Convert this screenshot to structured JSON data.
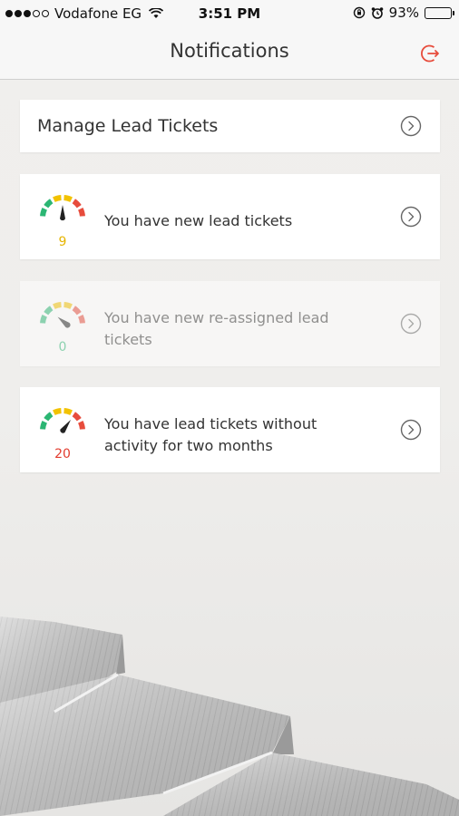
{
  "status_bar": {
    "carrier": "Vodafone EG",
    "time": "3:51 PM",
    "battery": "93%",
    "battery_level": 0.93
  },
  "nav": {
    "title": "Notifications",
    "logout_icon": "logout-icon"
  },
  "manage_card": {
    "title": "Manage Lead Tickets"
  },
  "notifications": [
    {
      "count": "9",
      "message": "You have new lead tickets",
      "count_color": "#e6b400",
      "enabled": true
    },
    {
      "count": "0",
      "message": "You have new re-assigned lead tickets",
      "count_color": "#2bb673",
      "enabled": false
    },
    {
      "count": "20",
      "message": "You have lead tickets without activity for two months",
      "count_color": "#e23b2e",
      "enabled": true
    }
  ],
  "colors": {
    "accent": "#e74c3c",
    "gauge_green": "#2bb673",
    "gauge_yellow": "#f2c200",
    "gauge_red": "#e74c3c"
  }
}
